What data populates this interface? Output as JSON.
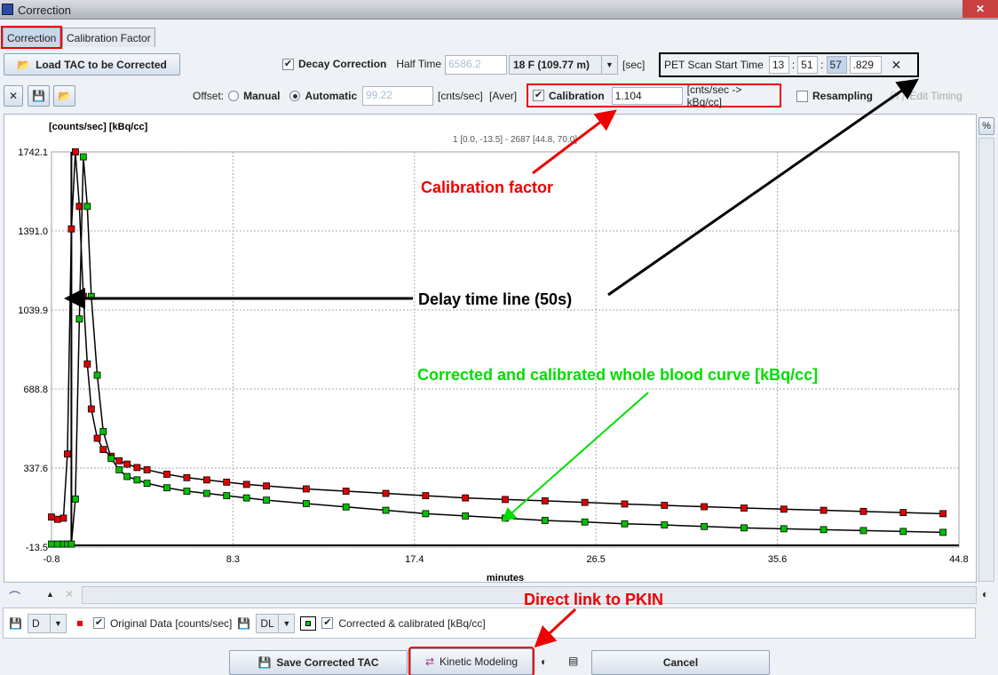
{
  "window": {
    "title": "Correction"
  },
  "tabs": [
    {
      "label": "Correction",
      "selected": true
    },
    {
      "label": "Calibration Factor",
      "selected": false
    }
  ],
  "toolbar": {
    "load_label": "Load TAC to be Corrected",
    "decay_correction_label": "Decay Correction",
    "decay_correction_checked": true,
    "half_time_label": "Half Time",
    "half_time_value": "6586.2",
    "isotope_value": "18 F (109.77 m)",
    "half_time_unit": "[sec]",
    "scan_start_label": "PET Scan Start Time",
    "scan_hh": "13",
    "scan_mm": "51",
    "scan_ss": "57",
    "scan_ms": ".829",
    "offset_label": "Offset:",
    "manual_label": "Manual",
    "automatic_label": "Automatic",
    "offset_mode": "Automatic",
    "offset_value": "99.22",
    "offset_unit": "[cnts/sec]",
    "offset_aver": "[Aver]",
    "calibration_label": "Calibration",
    "calibration_checked": true,
    "calibration_value": "1.104",
    "calibration_unit": "[cnts/sec -> kBq/cc]",
    "resampling_label": "Resampling",
    "resampling_checked": false,
    "edit_timing_label": "Edit Timing",
    "percent_label": "%"
  },
  "chart_data": {
    "type": "scatter",
    "ylabel": "[counts/sec] [kBq/cc]",
    "xlabel": "minutes",
    "range_label": "1 [0.0, -13.5] - 2687 [44.8, 70.0]",
    "xlim": [
      -0.8,
      44.8
    ],
    "ylim": [
      -13.5,
      1742.1
    ],
    "xticks": [
      "-0.8",
      "8.3",
      "17.4",
      "26.5",
      "35.6",
      "44.8"
    ],
    "yticks": [
      "1742.1",
      "1391.0",
      "1039.9",
      "688.8",
      "337.6",
      "-13.5"
    ],
    "grid": true,
    "delay_line_x": 0.2,
    "x": [
      -0.8,
      -0.5,
      -0.2,
      0.0,
      0.2,
      0.4,
      0.6,
      0.8,
      1.0,
      1.2,
      1.5,
      1.8,
      2.2,
      2.6,
      3,
      3.5,
      4,
      5,
      6,
      7,
      8,
      9,
      10,
      12,
      14,
      16,
      18,
      20,
      22,
      24,
      26,
      28,
      30,
      32,
      34,
      36,
      38,
      40,
      42,
      44
    ],
    "series": [
      {
        "name": "Original Data [counts/sec]",
        "color": "#e00000",
        "values": [
          120,
          110,
          115,
          400,
          1400,
          1742,
          1500,
          1100,
          800,
          600,
          470,
          420,
          390,
          370,
          355,
          340,
          330,
          310,
          295,
          285,
          275,
          265,
          258,
          245,
          235,
          225,
          215,
          205,
          198,
          192,
          185,
          178,
          172,
          166,
          160,
          155,
          150,
          145,
          140,
          135
        ]
      },
      {
        "name": "Corrected & calibrated [kBq/cc]",
        "color": "#00c000",
        "values": [
          0,
          0,
          0,
          0,
          0,
          200,
          1000,
          1720,
          1500,
          1100,
          750,
          500,
          380,
          330,
          300,
          285,
          270,
          250,
          235,
          225,
          215,
          205,
          195,
          180,
          165,
          150,
          135,
          125,
          115,
          105,
          98,
          90,
          85,
          78,
          72,
          68,
          64,
          60,
          56,
          52
        ]
      }
    ]
  },
  "annotations": {
    "calibration": "Calibration factor",
    "delay": "Delay time line (50s)",
    "curve": "Corrected and calibrated whole blood curve [kBq/cc]",
    "pkin": "Direct link to PKIN"
  },
  "legend": {
    "combo1": "D",
    "orig_label": "Original Data [counts/sec]",
    "combo2": "DL",
    "corr_label": "Corrected & calibrated [kBq/cc]"
  },
  "footer": {
    "save_label": "Save Corrected TAC",
    "kinetic_label": "Kinetic Modeling",
    "cancel_label": "Cancel"
  }
}
